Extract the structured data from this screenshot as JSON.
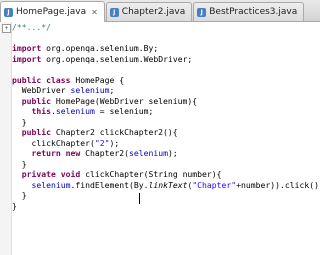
{
  "tabs": [
    {
      "label": "HomePage.java",
      "active": true
    },
    {
      "label": "Chapter2.java",
      "active": false
    },
    {
      "label": "BestPractices3.java",
      "active": false
    }
  ],
  "code": {
    "l1": "/**...*/",
    "l3a": "import",
    "l3b": " org.openqa.selenium.By;",
    "l4a": "import",
    "l4b": " org.openqa.selenium.WebDriver;",
    "l6a": "public class",
    "l6b": " HomePage {",
    "l7a": "  WebDriver ",
    "l7b": "selenium",
    "l7c": ";",
    "l8a": "  public",
    "l8b": " HomePage(WebDriver selenium){",
    "l9a": "    this",
    "l9b": ".",
    "l9c": "selenium",
    "l9d": " = selenium;",
    "l10": "  }",
    "l11a": "  public",
    "l11b": " Chapter2 clickChapter2(){",
    "l12a": "    clickChapter(",
    "l12b": "\"2\"",
    "l12c": ");",
    "l13a": "    return new",
    "l13b": " Chapter2(",
    "l13c": "selenium",
    "l13d": ");",
    "l14": "  }",
    "l15a": "  private void",
    "l15b": " clickChapter(String number){",
    "l16a": "    ",
    "l16b": "selenium",
    "l16c": ".findElement(By.",
    "l16d": "linkText",
    "l16e": "(",
    "l16f": "\"Chapter\"",
    "l16g": "+number)).click();",
    "l17": "  }",
    "l18": "}"
  }
}
